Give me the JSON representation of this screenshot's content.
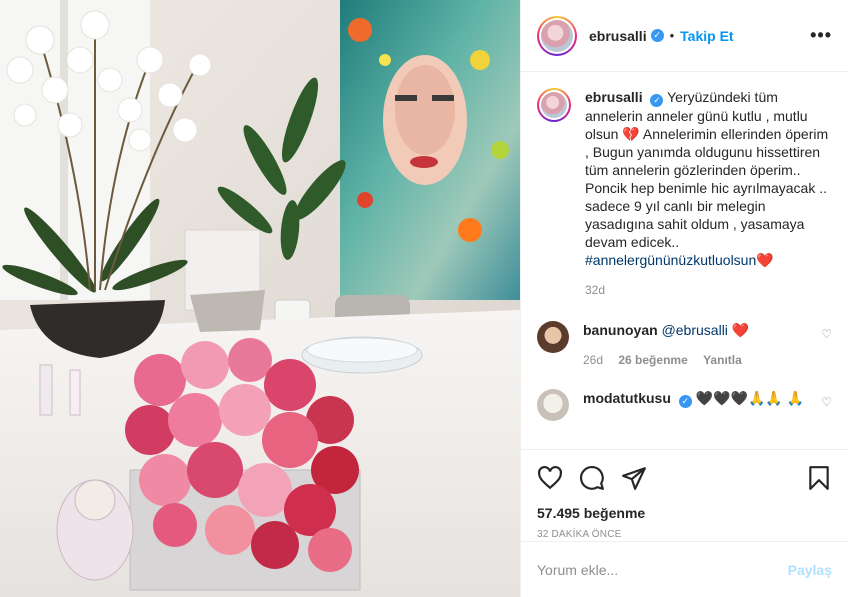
{
  "post": {
    "username": "ebrusalli",
    "verified_mark": "✓",
    "dot": "•",
    "follow_label": "Takip Et",
    "more_label": "•••"
  },
  "caption": {
    "username": "ebrusalli",
    "text_1": "Yeryüzündeki tüm annelerin anneler günü kutlu , mutlu olsun",
    "emoji_1": "💔",
    "text_2": "Annelerimin ellerinden öperim , Bugun yanımda oldugunu hissettiren tüm annelerin gözlerinden öperim.. Poncik hep benimle hic ayrılmayacak .. sadece 9 yıl canlı bir melegin yasadıgına sahit oldum , yasamaya devam edicek..",
    "hashtag": "#annelergününüzkutluolsun",
    "emoji_2": "❤️",
    "age": "32d"
  },
  "comments": [
    {
      "username": "banunoyan",
      "mention": "@ebrusalli",
      "emoji": "❤️",
      "age": "26d",
      "likes": "26 beğenme",
      "reply": "Yanıtla"
    },
    {
      "username": "modatutkusu",
      "text": "🖤🖤🖤🙏🙏 🙏"
    }
  ],
  "icons": {
    "like": "heart-icon",
    "comment": "comment-icon",
    "share": "share-icon",
    "save": "bookmark-icon",
    "comment_like": "♡"
  },
  "likes_count": "57.495 beğenme",
  "timestamp": "32 DAKİKA ÖNCE",
  "add_comment": {
    "placeholder": "Yorum ekle...",
    "post_label": "Paylaş"
  },
  "colors": {
    "accent_blue": "#0095f6",
    "verified": "#3897f0",
    "heart_red": "#ed4956",
    "muted": "#8e8e8e"
  }
}
